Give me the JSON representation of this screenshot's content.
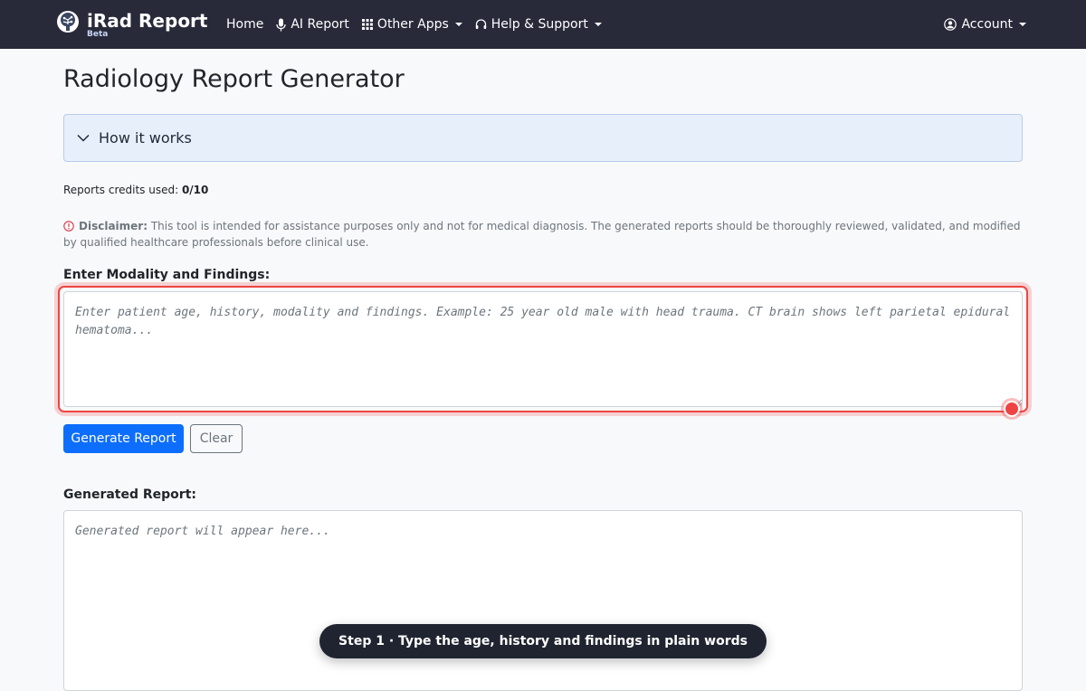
{
  "navbar": {
    "brand_title": "iRad Report",
    "brand_badge": "Beta",
    "items": [
      {
        "label": "Home",
        "icon": "none",
        "dropdown": false
      },
      {
        "label": "AI Report",
        "icon": "microphone-icon",
        "dropdown": false
      },
      {
        "label": "Other Apps",
        "icon": "grid-icon",
        "dropdown": true
      },
      {
        "label": "Help & Support",
        "icon": "headset-icon",
        "dropdown": true
      }
    ],
    "account_label": "Account",
    "background": "#282a3a"
  },
  "main": {
    "page_title": "Radiology Report Generator",
    "accordion_label": "How it works",
    "credits_prefix": "Reports credits used: ",
    "credits_value": "0/10",
    "disclaimer_label": "Disclaimer:",
    "disclaimer_text": " This tool is intended for assistance purposes only and not for medical diagnosis. The generated reports should be thoroughly reviewed, validated, and modified by qualified healthcare professionals before clinical use.",
    "findings_label": "Enter Modality and Findings:",
    "findings_placeholder": "Enter patient age, history, modality and findings. Example: 25 year old male with head trauma. CT brain shows left parietal epidural hematoma...",
    "findings_value": "",
    "generate_button": "Generate Report",
    "clear_button": "Clear",
    "generated_label": "Generated Report:",
    "generated_placeholder": "Generated report will appear here...",
    "generated_value": ""
  },
  "overlay": {
    "step_toast": "Step 1 · Type the age, history and findings in plain words",
    "highlight_color": "#ef4444"
  },
  "colors": {
    "primary": "#0d6efd",
    "accordion_bg": "#e7effb",
    "muted_text": "#6c757d",
    "warning_icon": "#dc3545"
  }
}
